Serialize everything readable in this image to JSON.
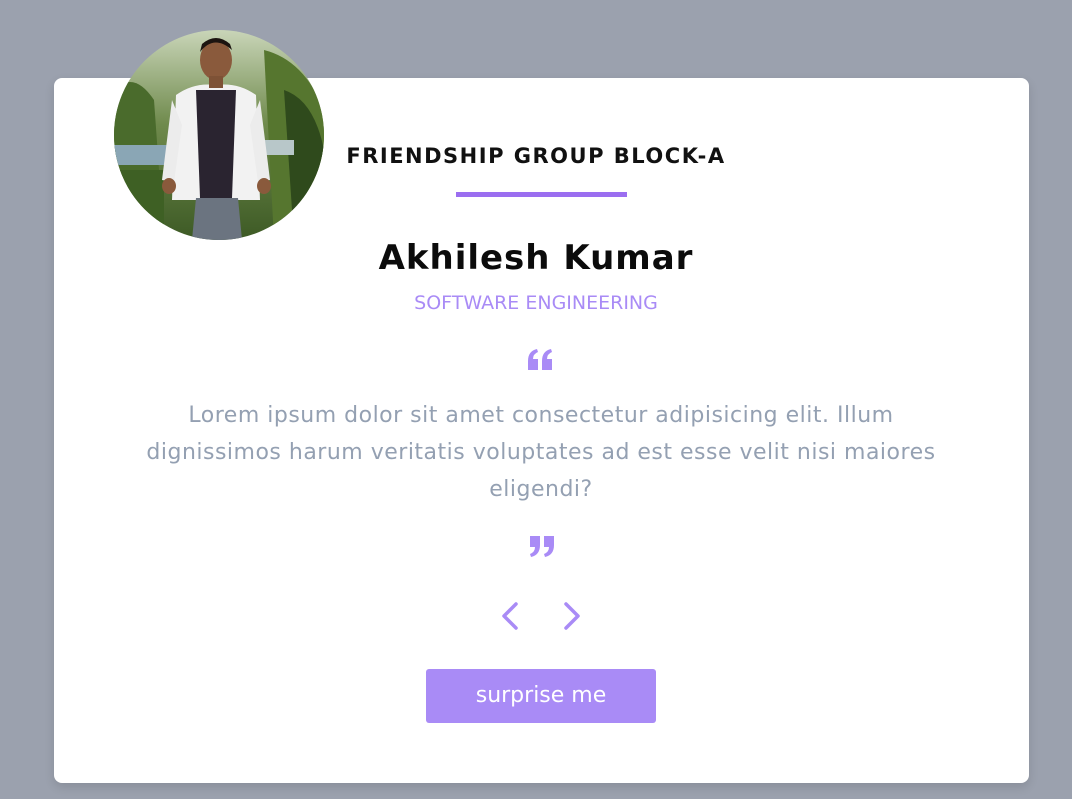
{
  "colors": {
    "background": "#9ba1ae",
    "card": "#ffffff",
    "accent": "#9b6ef0",
    "accent_light": "#a98bf6",
    "text_dark": "#0b0b0b",
    "text_muted": "#94a0b2"
  },
  "header": {
    "group_title": "FRIENDSHIP GROUP BLOCK-A"
  },
  "review": {
    "name": "Akhilesh Kumar",
    "job": "SOFTWARE ENGINEERING",
    "text": "Lorem ipsum dolor sit amet consectetur adipisicing elit. Illum dignissimos harum veritatis voluptates ad est esse velit nisi maiores eligendi?",
    "avatar_icon": "person-photo"
  },
  "icons": {
    "quote_open": "quote-left-icon",
    "quote_close": "quote-right-icon",
    "prev": "chevron-left-icon",
    "next": "chevron-right-icon"
  },
  "actions": {
    "surprise_label": "surprise me"
  }
}
